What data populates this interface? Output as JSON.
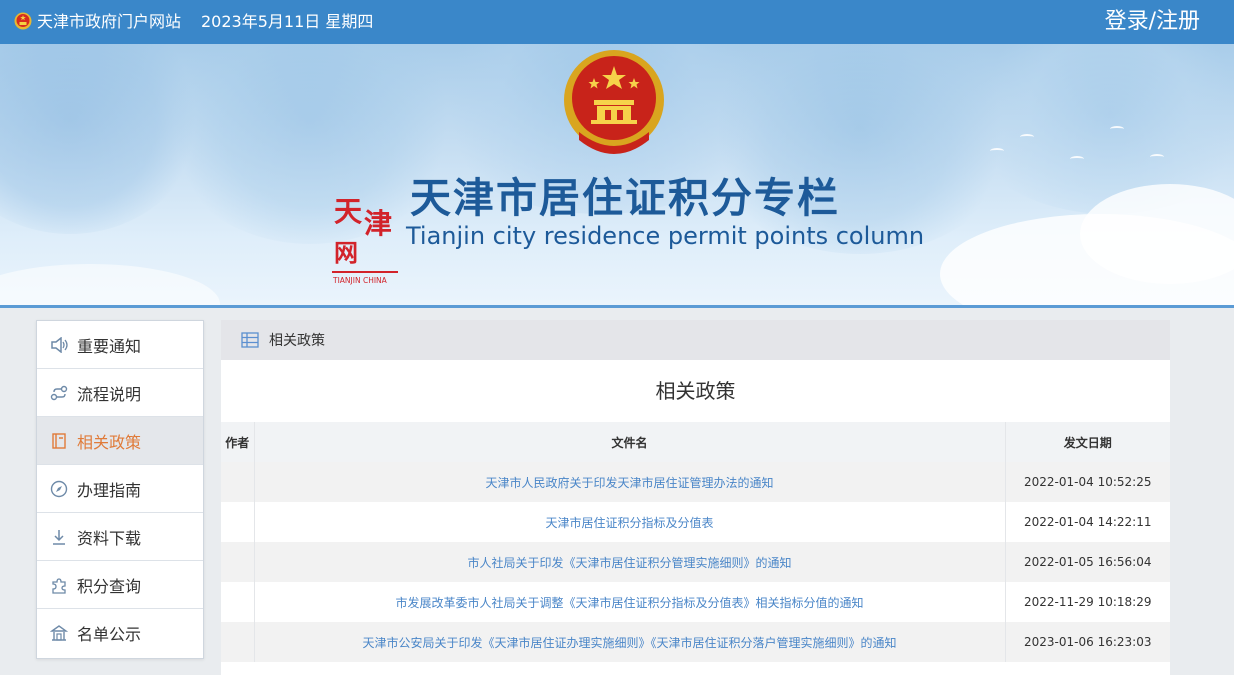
{
  "topbar": {
    "site_name": "天津市政府门户网站",
    "date": "2023年5月11日 星期四",
    "login_label": "登录/注册"
  },
  "banner": {
    "title": "天津市居住证积分专栏",
    "subtitle": "Tianjin city residence permit points column",
    "logo_text": "天津 TIANJIN CHINA"
  },
  "sidebar": {
    "items": [
      {
        "label": "重要通知",
        "icon": "speaker-icon",
        "active": false
      },
      {
        "label": "流程说明",
        "icon": "flow-icon",
        "active": false
      },
      {
        "label": "相关政策",
        "icon": "book-icon",
        "active": true
      },
      {
        "label": "办理指南",
        "icon": "compass-icon",
        "active": false
      },
      {
        "label": "资料下载",
        "icon": "download-icon",
        "active": false
      },
      {
        "label": "积分查询",
        "icon": "puzzle-icon",
        "active": false
      },
      {
        "label": "名单公示",
        "icon": "building-icon",
        "active": false
      }
    ]
  },
  "panel": {
    "breadcrumb": "相关政策",
    "title": "相关政策",
    "columns": {
      "author": "作者",
      "document": "文件名",
      "date": "发文日期"
    },
    "rows": [
      {
        "author": "",
        "document": "天津市人民政府关于印发天津市居住证管理办法的通知",
        "date": "2022-01-04 10:52:25"
      },
      {
        "author": "",
        "document": "天津市居住证积分指标及分值表",
        "date": "2022-01-04 14:22:11"
      },
      {
        "author": "",
        "document": "市人社局关于印发《天津市居住证积分管理实施细则》的通知",
        "date": "2022-01-05 16:56:04"
      },
      {
        "author": "",
        "document": "市发展改革委市人社局关于调整《天津市居住证积分指标及分值表》相关指标分值的通知",
        "date": "2022-11-29 10:18:29"
      },
      {
        "author": "",
        "document": "天津市公安局关于印发《天津市居住证办理实施细则》《天津市居住证积分落户管理实施细则》的通知",
        "date": "2023-01-06 16:23:03"
      }
    ]
  },
  "colors": {
    "topbar": "#3a87c9",
    "title_blue": "#1d5a99",
    "link": "#4a86c8",
    "active": "#e07b39"
  }
}
